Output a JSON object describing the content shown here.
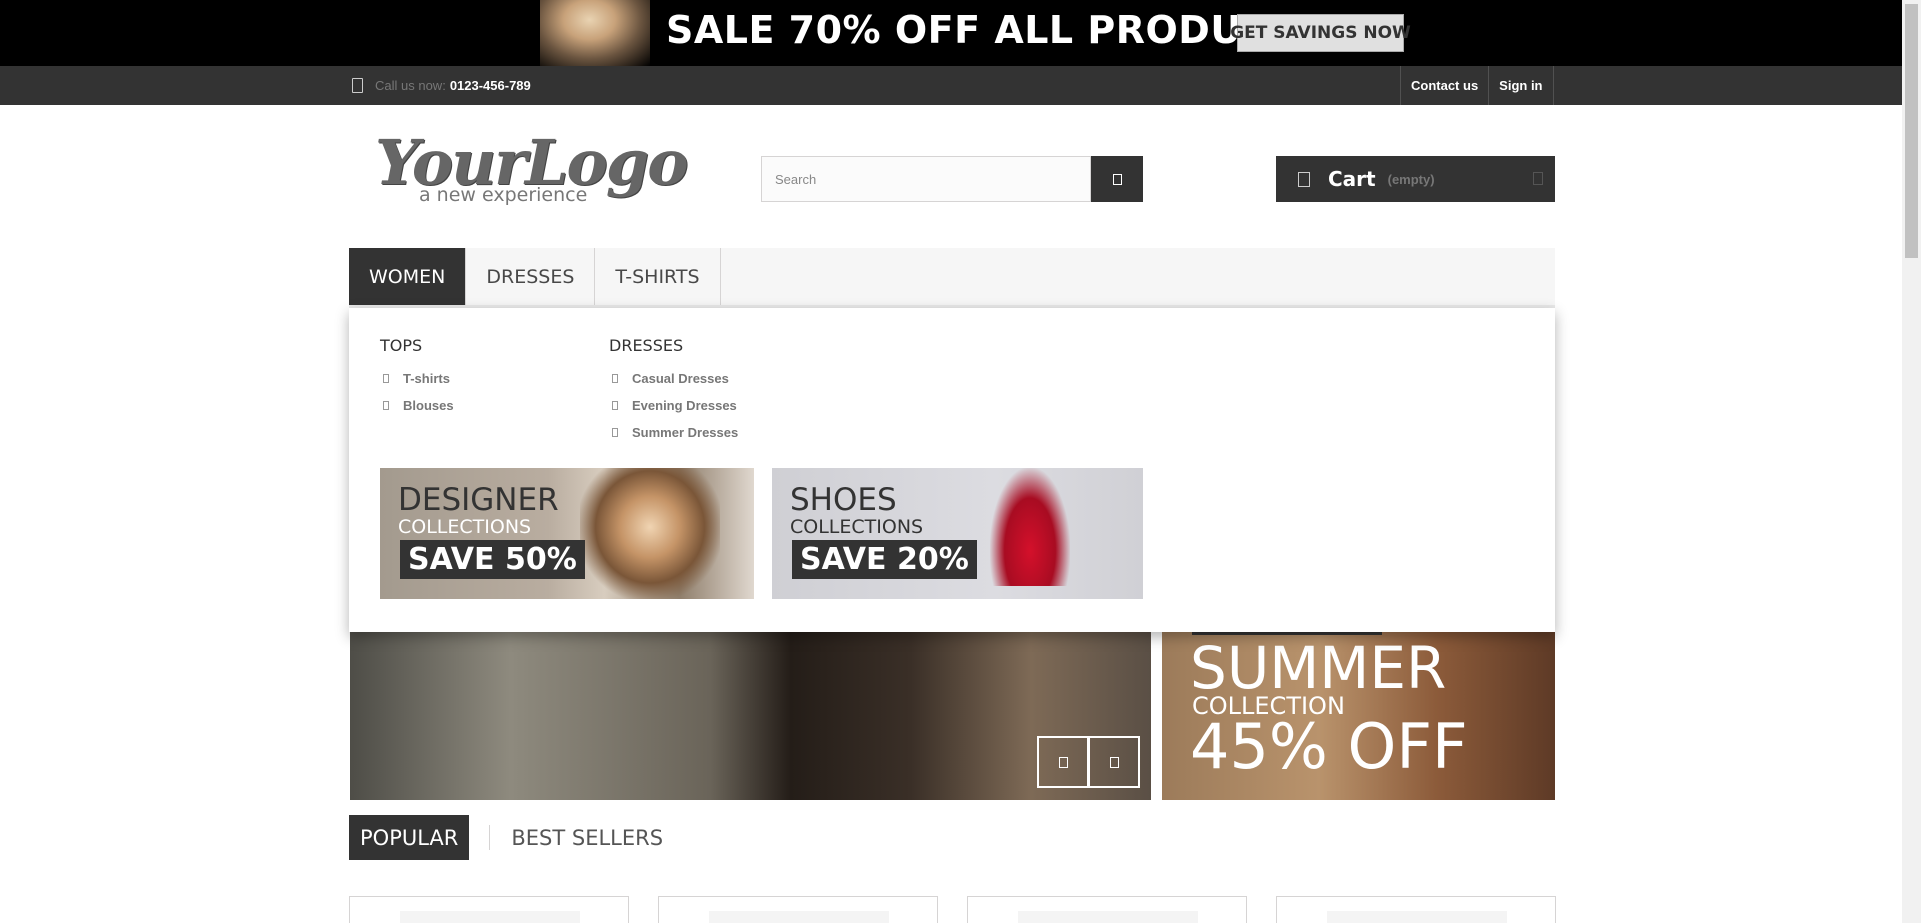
{
  "promo": {
    "headline": "SALE 70% OFF ALL PRODUCTS",
    "button_label": "GET SAVINGS NOW"
  },
  "topbar": {
    "call_label": "Call us now:",
    "phone": "0123-456-789",
    "links": [
      "Contact us",
      "Sign in"
    ]
  },
  "header": {
    "logo_main": "YourLogo",
    "logo_sub": "a new experience",
    "search_placeholder": "Search",
    "cart_label": "Cart",
    "cart_status": "(empty)"
  },
  "menu": {
    "items": [
      "WOMEN",
      "DRESSES",
      "T-SHIRTS"
    ],
    "active": "WOMEN"
  },
  "dropdown": {
    "columns": [
      {
        "title": "TOPS",
        "links": [
          "T-shirts",
          "Blouses"
        ]
      },
      {
        "title": "DRESSES",
        "links": [
          "Casual Dresses",
          "Evening Dresses",
          "Summer Dresses"
        ]
      }
    ],
    "banners": [
      {
        "headline": "DESIGNER",
        "sub": "COLLECTIONS",
        "save": "SAVE 50%"
      },
      {
        "headline": "SHOES",
        "sub": "COLLECTIONS",
        "save": "SAVE 20%"
      }
    ]
  },
  "summer_banner": {
    "headline": "SUMMER",
    "sub": "COLLECTION",
    "offer": "45% OFF"
  },
  "tabs": {
    "items": [
      "POPULAR",
      "BEST SELLERS"
    ],
    "active": "POPULAR"
  },
  "icons": {
    "phone": "phone-icon",
    "search": "search-icon",
    "cart": "cart-icon",
    "bullet": "chevron-right-icon",
    "slider_prev": "chevron-left-icon",
    "slider_next": "chevron-right-icon"
  },
  "colors": {
    "dark": "#333333",
    "topbar": "#333333",
    "menu_bg": "#f6f6f6",
    "promo_bg": "#000000"
  }
}
